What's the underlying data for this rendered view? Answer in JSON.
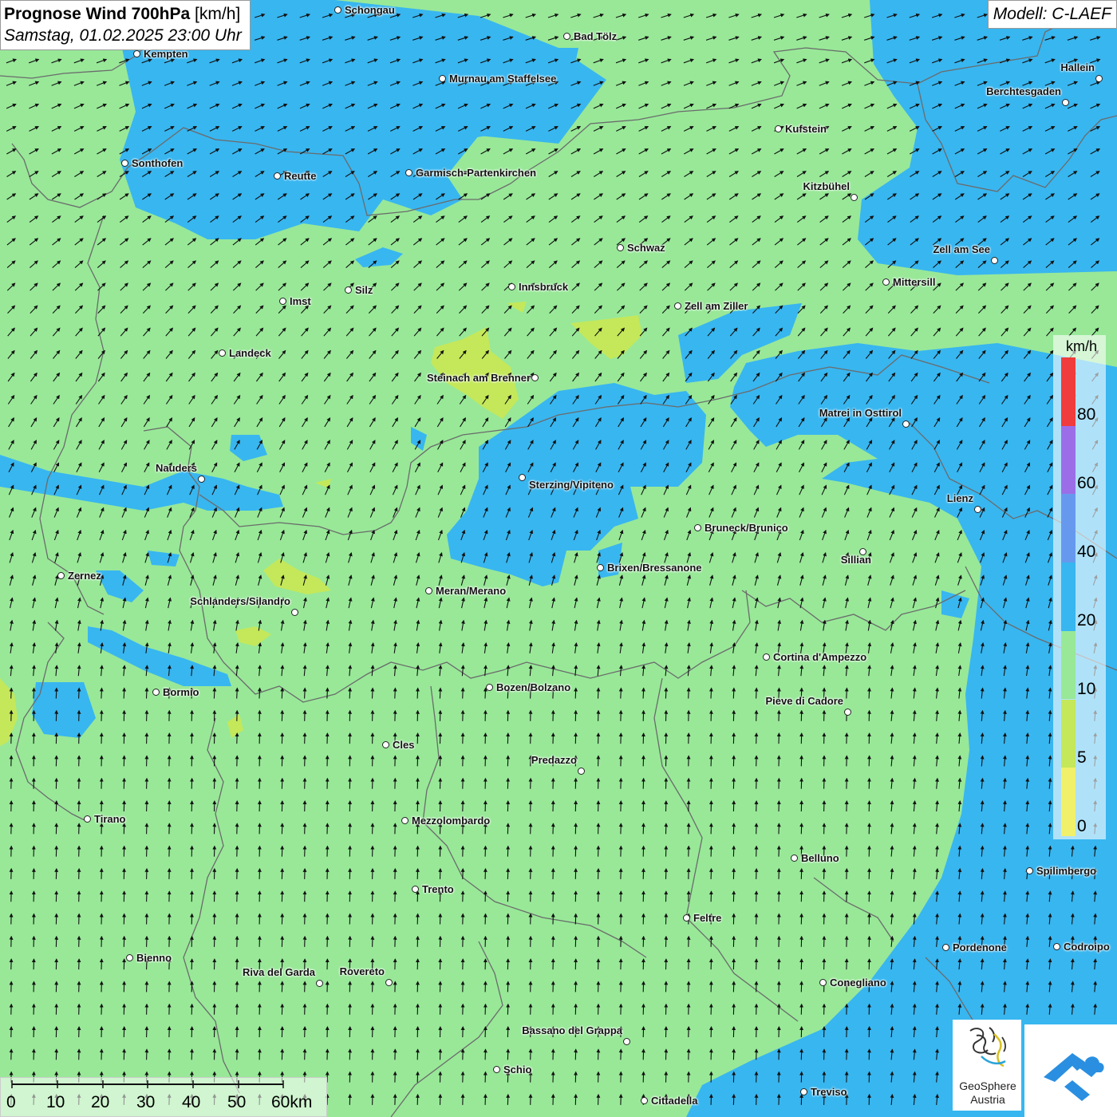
{
  "header": {
    "title_bold": "Prognose Wind 700hPa",
    "title_unit": "[km/h]",
    "datetime": "Samstag, 01.02.2025 23:00 Uhr",
    "model": "Modell: C-LAEF"
  },
  "legend": {
    "unit": "km/h",
    "ticks": [
      "80",
      "60",
      "40",
      "20",
      "10",
      "5",
      "0"
    ],
    "colors": [
      "#f03c3c",
      "#9b6ee8",
      "#6699ee",
      "#38b6f0",
      "#98e898",
      "#c4e85a",
      "#f0f06a"
    ]
  },
  "scale_bar": {
    "labels": [
      "0",
      "10",
      "20",
      "30",
      "40",
      "50",
      "60km"
    ]
  },
  "logos": {
    "geosphere_line1": "GeoSphere",
    "geosphere_line2": "Austria"
  },
  "colors": {
    "wind_10_20": "#98e898",
    "wind_20_40": "#38b6f0",
    "wind_5_10": "#c4e85a",
    "wind_0_5": "#f0f06a"
  },
  "cities": [
    {
      "name": "Schongau"
    },
    {
      "name": "Kempten"
    },
    {
      "name": "Bad Tölz"
    },
    {
      "name": "Murnau am Staffelsee"
    },
    {
      "name": "Hallein"
    },
    {
      "name": "Berchtesgaden"
    },
    {
      "name": "Kufstein"
    },
    {
      "name": "Sonthofen"
    },
    {
      "name": "Reutte"
    },
    {
      "name": "Garmisch-Partenkirchen"
    },
    {
      "name": "Kitzbühel"
    },
    {
      "name": "Schwaz"
    },
    {
      "name": "Zell am See"
    },
    {
      "name": "Mittersill"
    },
    {
      "name": "Silz"
    },
    {
      "name": "Innsbruck"
    },
    {
      "name": "Imst"
    },
    {
      "name": "Zell am Ziller"
    },
    {
      "name": "Landeck"
    },
    {
      "name": "Steinach am Brenner"
    },
    {
      "name": "Matrei in Osttirol"
    },
    {
      "name": "Nauders"
    },
    {
      "name": "Sterzing/Vipiteno"
    },
    {
      "name": "Lienz"
    },
    {
      "name": "Bruneck/Brunico"
    },
    {
      "name": "Sillian"
    },
    {
      "name": "Zernez"
    },
    {
      "name": "Brixen/Bressanone"
    },
    {
      "name": "Meran/Merano"
    },
    {
      "name": "Schlanders/Silandro"
    },
    {
      "name": "Cortina d'Ampezzo"
    },
    {
      "name": "Bormio"
    },
    {
      "name": "Bozen/Bolzano"
    },
    {
      "name": "Pieve di Cadore"
    },
    {
      "name": "Cles"
    },
    {
      "name": "Predazzo"
    },
    {
      "name": "Tirano"
    },
    {
      "name": "Mezzolombardo"
    },
    {
      "name": "Belluno"
    },
    {
      "name": "Spilimbergo"
    },
    {
      "name": "Trento"
    },
    {
      "name": "Feltre"
    },
    {
      "name": "Pordenone"
    },
    {
      "name": "Codroipo"
    },
    {
      "name": "Bienno"
    },
    {
      "name": "Riva del Garda"
    },
    {
      "name": "Rovereto"
    },
    {
      "name": "Conegliano"
    },
    {
      "name": "Bassano del Grappa"
    },
    {
      "name": "Schio"
    },
    {
      "name": "Treviso"
    },
    {
      "name": "Cittadella"
    }
  ]
}
